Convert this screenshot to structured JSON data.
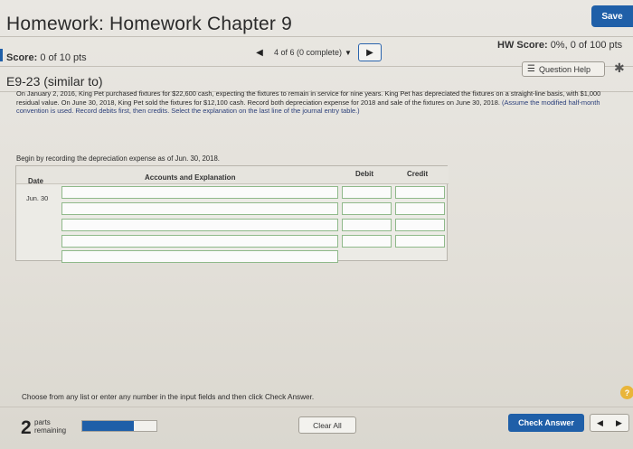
{
  "header": {
    "title": "Homework: Homework Chapter 9",
    "save_label": "Save"
  },
  "score": {
    "label": "Score:",
    "value": "0 of 10 pts"
  },
  "question_nav": {
    "prev_icon": "triangle-left-icon",
    "label": "4 of 6 (0 complete)",
    "caret_icon": "caret-down-icon",
    "next_icon": "triangle-right-icon"
  },
  "hw_score": {
    "label": "HW Score:",
    "value": "0%, 0 of 100 pts"
  },
  "problem": {
    "id": "E9-23 (similar to)",
    "question_help_label": "Question Help",
    "question_help_icon": "list-icon",
    "settings_icon": "gear-icon",
    "text": "On January 2, 2016, King Pet purchased fixtures for $22,600 cash, expecting the fixtures to remain in service for nine years. King Pet has depreciated the fixtures on a straight-line basis, with $1,000 residual value. On June 30, 2018, King Pet sold the fixtures for $12,100 cash. Record both depreciation expense for 2018 and sale of the fixtures on June 30, 2018.",
    "assumption": "(Assume the modified half-month convention is used. Record debits first, then credits. Select the explanation on the last line of the journal entry table.)"
  },
  "journal": {
    "instruction": "Begin by recording the depreciation expense as of Jun. 30, 2018.",
    "columns": {
      "date": "Date",
      "accounts": "Accounts and Explanation",
      "debit": "Debit",
      "credit": "Credit"
    },
    "date_value": "Jun. 30"
  },
  "footer": {
    "instruction": "Choose from any list or enter any number in the input fields and then click Check Answer.",
    "help_icon": "question-mark-icon",
    "parts_count": "2",
    "parts_label": "parts remaining",
    "progress_fraction": 0.7,
    "clear_label": "Clear All",
    "check_label": "Check Answer"
  },
  "colors": {
    "accent": "#1f5fa8",
    "help": "#e9b53a",
    "input_border": "#8fb98a"
  }
}
